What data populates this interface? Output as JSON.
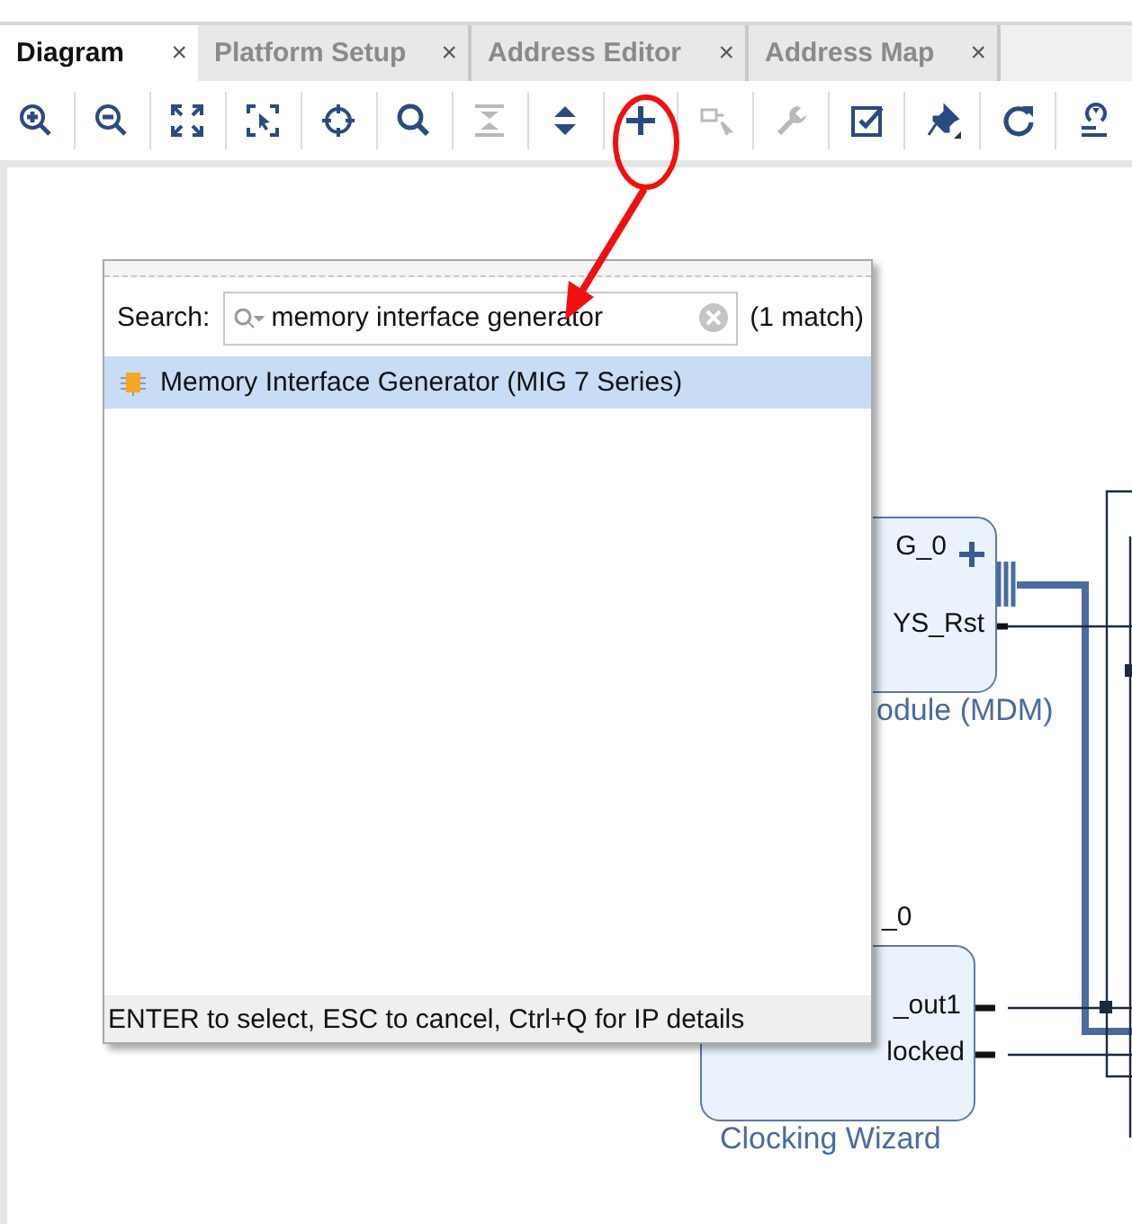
{
  "tabs": [
    {
      "label": "Diagram",
      "selected": true,
      "close": "×"
    },
    {
      "label": "Platform Setup",
      "selected": false,
      "close": "×"
    },
    {
      "label": "Address Editor",
      "selected": false,
      "close": "×"
    },
    {
      "label": "Address Map",
      "selected": false,
      "close": "×"
    }
  ],
  "toolbar": {
    "buttons": [
      {
        "kind": "zoom-in",
        "disabled": false
      },
      {
        "kind": "zoom-out",
        "disabled": false
      },
      {
        "kind": "fit",
        "disabled": false
      },
      {
        "kind": "zoom-area",
        "disabled": false
      },
      {
        "kind": "center",
        "disabled": false
      },
      {
        "kind": "search",
        "disabled": false
      },
      {
        "kind": "collapse",
        "disabled": true
      },
      {
        "kind": "expand",
        "disabled": false
      },
      {
        "kind": "add",
        "disabled": false
      },
      {
        "kind": "connect",
        "disabled": true
      },
      {
        "kind": "wrench",
        "disabled": true
      },
      {
        "kind": "validate",
        "disabled": false
      },
      {
        "kind": "pin",
        "disabled": false
      },
      {
        "kind": "refresh",
        "disabled": false
      },
      {
        "kind": "regenerate",
        "disabled": false
      }
    ]
  },
  "diagram": {
    "blocks": [
      {
        "pins": [
          "G_0",
          "YS_Rst"
        ],
        "title": "odule (MDM)"
      },
      {
        "instance": "_0",
        "pins": [
          "_out1",
          "locked"
        ],
        "title": "Clocking Wizard"
      }
    ]
  },
  "search_popup": {
    "label": "Search:",
    "value": "memory interface generator",
    "match_count": "(1 match)",
    "results": [
      {
        "label": "Memory Interface Generator (MIG 7 Series)",
        "selected": true
      }
    ],
    "hint": "ENTER to select, ESC to cancel, Ctrl+Q for IP details"
  },
  "annotations": [
    {
      "kind": "circle"
    },
    {
      "kind": "arrow"
    }
  ]
}
